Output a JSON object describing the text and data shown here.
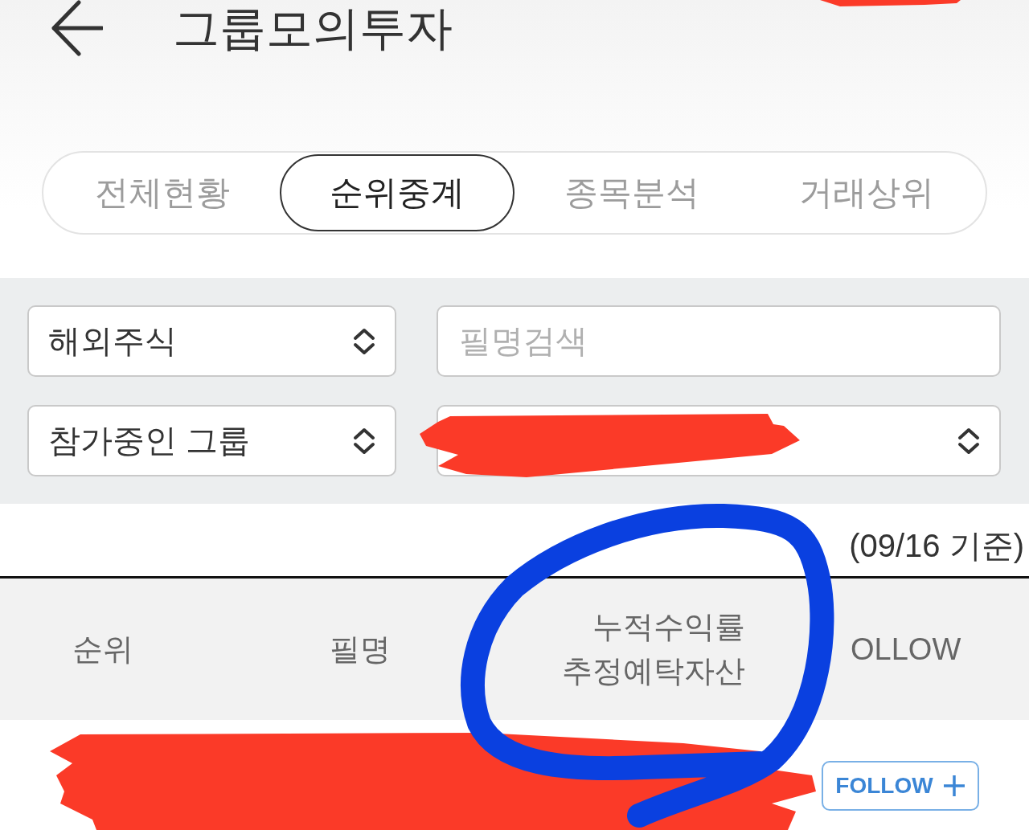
{
  "header": {
    "title": "그룹모의투자"
  },
  "tabs": [
    {
      "label": "전체현황",
      "selected": false
    },
    {
      "label": "순위중계",
      "selected": true
    },
    {
      "label": "종목분석",
      "selected": false
    },
    {
      "label": "거래상위",
      "selected": false
    }
  ],
  "filters": [
    {
      "kind": "select",
      "value": "해외주식"
    },
    {
      "kind": "search",
      "placeholder": "필명검색"
    },
    {
      "kind": "select",
      "value": "참가중인 그룹"
    },
    {
      "kind": "select"
    }
  ],
  "as_of": "(09/16 기준)",
  "table": {
    "columns": [
      {
        "labels": [
          "순위"
        ]
      },
      {
        "labels": [
          "필명"
        ]
      },
      {
        "labels": [
          "누적수익률",
          "추정예탁자산"
        ]
      },
      {
        "labels": [
          "OLLOW"
        ]
      }
    ],
    "rows": [
      {
        "follow": "FOLLOW"
      }
    ]
  },
  "annotations": [
    {
      "kind": "redaction",
      "color": "#fb3a28"
    },
    {
      "kind": "redaction",
      "color": "#fb3a28"
    },
    {
      "kind": "redaction",
      "color": "#fb3a28"
    },
    {
      "kind": "circle",
      "color": "#0a40e0"
    }
  ]
}
